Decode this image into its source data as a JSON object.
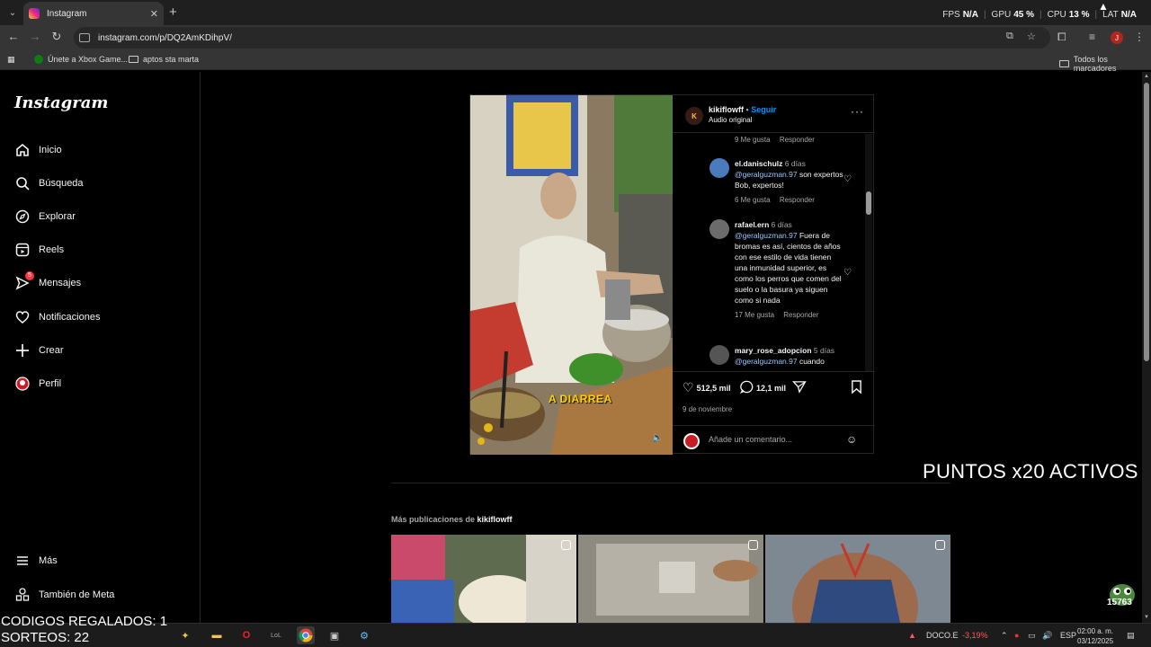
{
  "browser": {
    "tab_title": "Instagram",
    "url": "instagram.com/p/DQ2AmKDihpV/",
    "bookmarks": [
      "Únete a Xbox Game...",
      "aptos sta marta"
    ],
    "all_bookmarks": "Todos los marcadores",
    "profile_initial": "J"
  },
  "perf_overlay": {
    "fps_label": "FPS",
    "fps_value": "N/A",
    "gpu_label": "GPU",
    "gpu_value": "45 %",
    "cpu_label": "CPU",
    "cpu_value": "13 %",
    "lat_label": "LAT",
    "lat_value": "N/A"
  },
  "sidebar": {
    "logo": "Instagram",
    "items": [
      {
        "label": "Inicio",
        "icon": "home-icon"
      },
      {
        "label": "Búsqueda",
        "icon": "search-icon"
      },
      {
        "label": "Explorar",
        "icon": "compass-icon"
      },
      {
        "label": "Reels",
        "icon": "reels-icon"
      },
      {
        "label": "Mensajes",
        "icon": "messenger-icon",
        "badge": "5"
      },
      {
        "label": "Notificaciones",
        "icon": "heart-icon"
      },
      {
        "label": "Crear",
        "icon": "plus-icon"
      },
      {
        "label": "Perfil",
        "icon": "avatar-icon"
      }
    ],
    "more": "Más",
    "meta": "También de Meta"
  },
  "post": {
    "username": "kikiflowff",
    "follow": "Seguir",
    "audio": "Audio original",
    "video_caption": "A DIARREA",
    "top_meta": {
      "likes": "9 Me gusta",
      "reply": "Responder"
    },
    "comments": [
      {
        "user": "el.danischulz",
        "time": "6 días",
        "mention": "@geralguzman.97",
        "text": " son expertos Bob, expertos!",
        "likes": "6 Me gusta",
        "reply": "Responder"
      },
      {
        "user": "rafael.ern",
        "time": "6 días",
        "mention": "@geralguzman.97",
        "text": " Fuera de bromas es así, cientos de años con ese estilo de vida tienen una inmunidad superior, es como los perros que comen del suelo o la basura ya siguen como si nada",
        "likes": "17 Me gusta",
        "reply": "Responder"
      },
      {
        "user": "mary_rose_adopcion",
        "time": "5 días",
        "mention": "@geralguzman.97",
        "text": " cuando",
        "likes": "",
        "reply": ""
      }
    ],
    "like_count": "512,5 mil",
    "comment_count": "12,1 mil",
    "date": "9 de noviembre",
    "comment_placeholder": "Añade un comentario..."
  },
  "more_posts": {
    "prefix": "Más publicaciones de ",
    "user": "kikiflowff"
  },
  "stream_overlay": {
    "puntos": "PUNTOS x20 ACTIVOS",
    "codigos": "CODIGOS REGALADOS: 1",
    "sorteos": "SORTEOS: 22",
    "pepe_count": "15763"
  },
  "taskbar": {
    "stock_name": "DOCO.E",
    "stock_change": "-3,19%",
    "lang": "ESP",
    "time": "02:00 a. m.",
    "date": "03/12/2025"
  },
  "colors": {
    "accent": "#0095f6",
    "badge": "#ff3040",
    "stock_down": "#ff5a5a"
  }
}
